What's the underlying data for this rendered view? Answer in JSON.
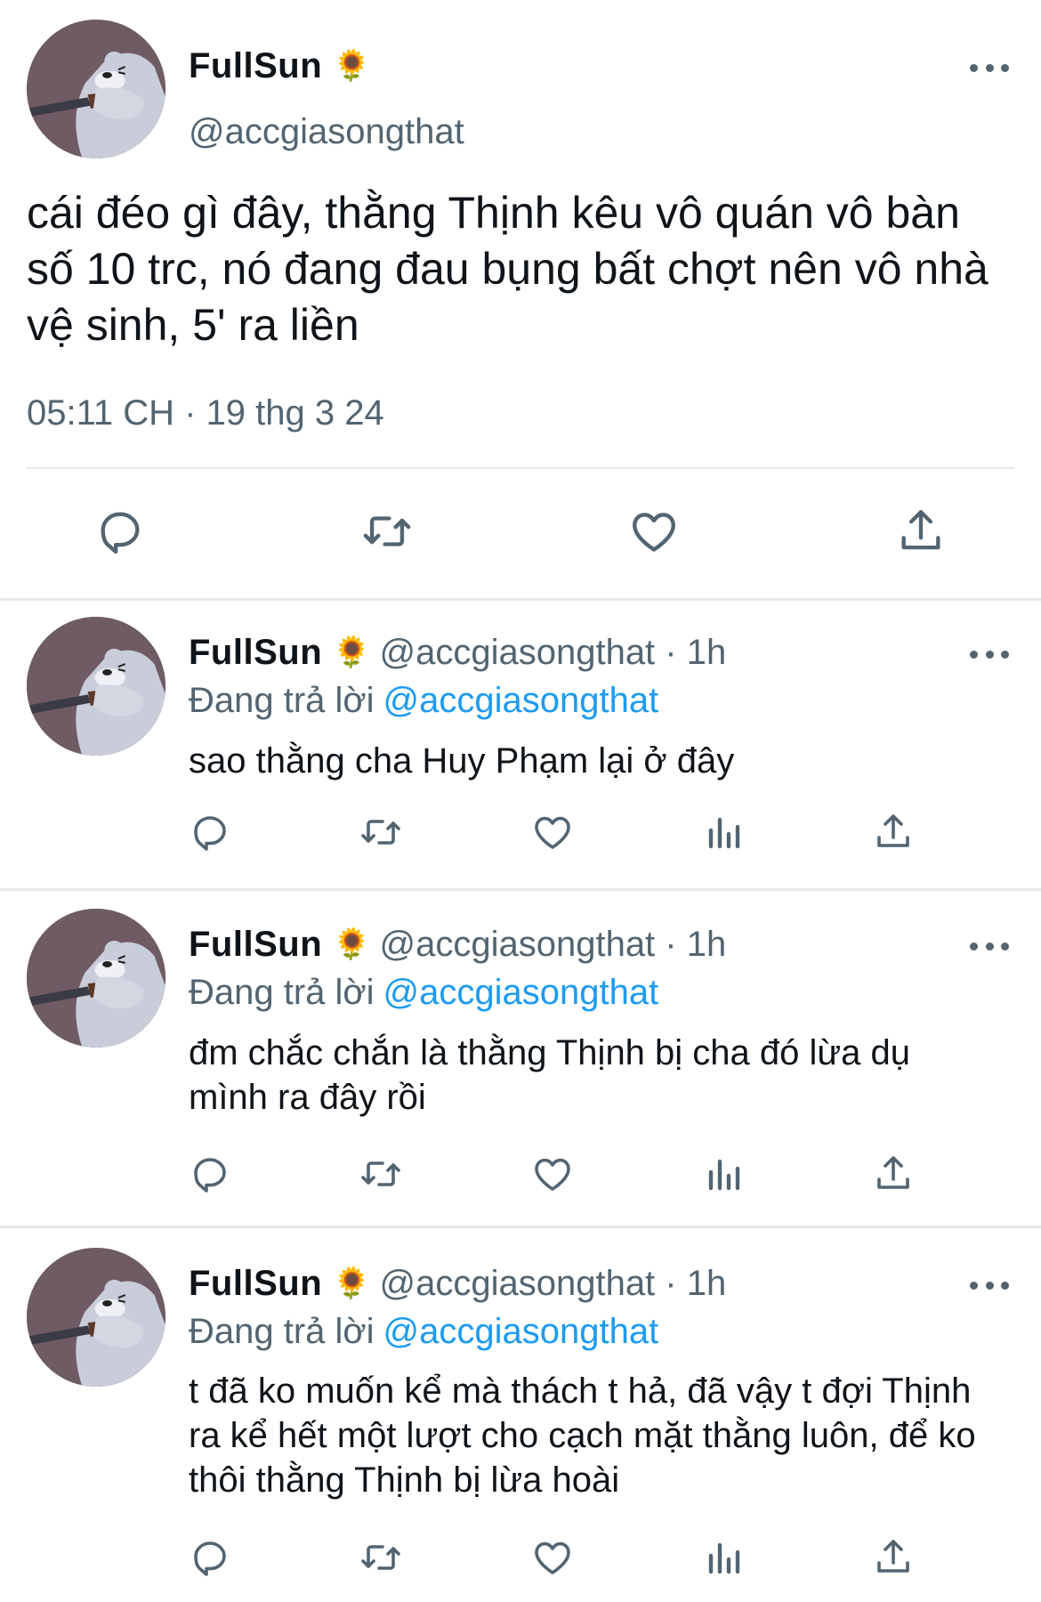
{
  "main_tweet": {
    "display_name": "FullSun",
    "name_emoji": "🌻",
    "handle": "@accgiasongthat",
    "text": "cái đéo gì đây, thằng Thịnh kêu vô quán vô bàn số 10 trc, nó đang đau bụng bất chợt nên vô nhà vệ sinh, 5' ra liền",
    "timestamp": "05:11 CH · 19 thg 3 24",
    "actions": [
      "reply-icon",
      "retweet-icon",
      "like-icon",
      "share-icon"
    ]
  },
  "replies": [
    {
      "display_name": "FullSun",
      "name_emoji": "🌻",
      "handle_time": "@accgiasongthat · 1h",
      "replying_prefix": "Đang trả lời",
      "replying_to": "@accgiasongthat",
      "text": "sao thằng cha Huy Phạm lại ở đây"
    },
    {
      "display_name": "FullSun",
      "name_emoji": "🌻",
      "handle_time": "@accgiasongthat · 1h",
      "replying_prefix": "Đang trả lời",
      "replying_to": "@accgiasongthat",
      "text": "đm chắc chắn là thằng Thịnh bị cha đó lừa dụ mình ra đây rồi"
    },
    {
      "display_name": "FullSun",
      "name_emoji": "🌻",
      "handle_time": "@accgiasongthat · 1h",
      "replying_prefix": "Đang trả lời",
      "replying_to": "@accgiasongthat",
      "text": "t đã ko muốn kể mà thách t hả, đã vậy t đợi Thịnh ra kể hết một lượt cho cạch mặt thằng luôn, để ko thôi thằng Thịnh bị lừa hoài"
    }
  ],
  "reply_actions": [
    "reply-icon",
    "retweet-icon",
    "like-icon",
    "views-icon",
    "share-icon"
  ],
  "colors": {
    "text": "#0f1419",
    "secondary": "#536471",
    "link": "#1d9bf0",
    "divider": "#e6e9ec"
  }
}
